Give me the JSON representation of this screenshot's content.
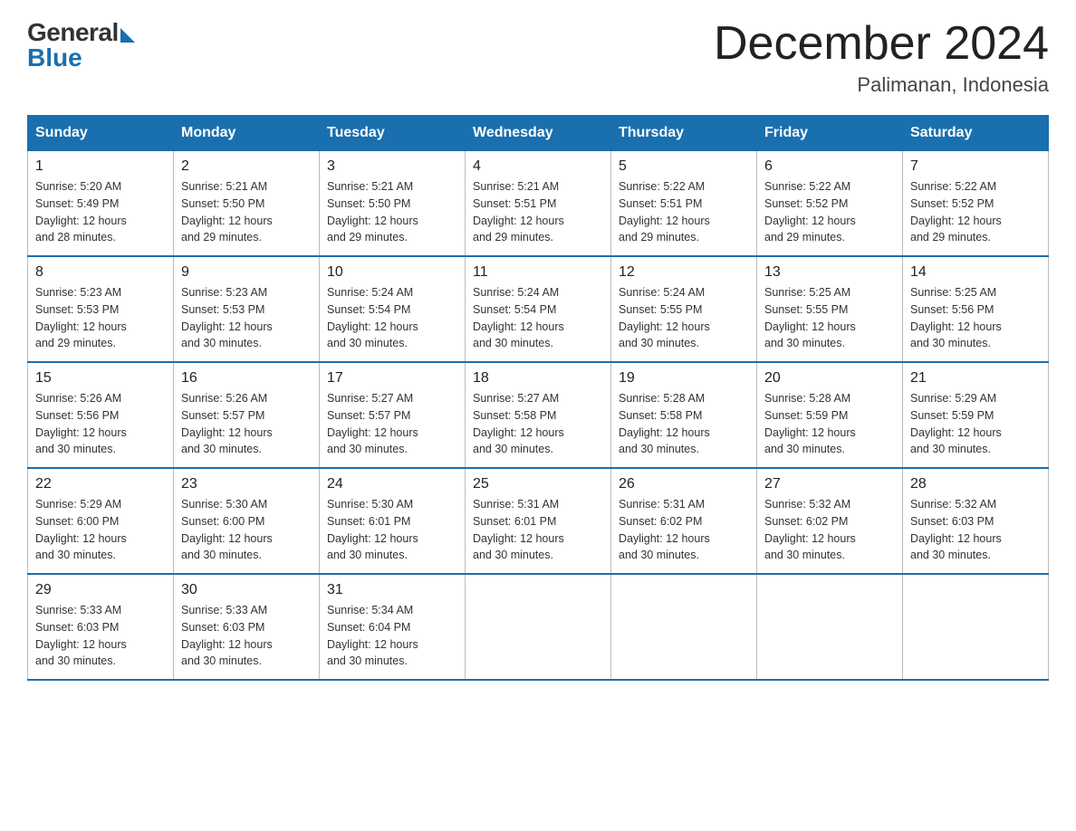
{
  "logo": {
    "general": "General",
    "blue": "Blue"
  },
  "header": {
    "title": "December 2024",
    "location": "Palimanan, Indonesia"
  },
  "weekdays": [
    "Sunday",
    "Monday",
    "Tuesday",
    "Wednesday",
    "Thursday",
    "Friday",
    "Saturday"
  ],
  "weeks": [
    [
      {
        "day": "1",
        "sunrise": "5:20 AM",
        "sunset": "5:49 PM",
        "daylight": "12 hours and 28 minutes."
      },
      {
        "day": "2",
        "sunrise": "5:21 AM",
        "sunset": "5:50 PM",
        "daylight": "12 hours and 29 minutes."
      },
      {
        "day": "3",
        "sunrise": "5:21 AM",
        "sunset": "5:50 PM",
        "daylight": "12 hours and 29 minutes."
      },
      {
        "day": "4",
        "sunrise": "5:21 AM",
        "sunset": "5:51 PM",
        "daylight": "12 hours and 29 minutes."
      },
      {
        "day": "5",
        "sunrise": "5:22 AM",
        "sunset": "5:51 PM",
        "daylight": "12 hours and 29 minutes."
      },
      {
        "day": "6",
        "sunrise": "5:22 AM",
        "sunset": "5:52 PM",
        "daylight": "12 hours and 29 minutes."
      },
      {
        "day": "7",
        "sunrise": "5:22 AM",
        "sunset": "5:52 PM",
        "daylight": "12 hours and 29 minutes."
      }
    ],
    [
      {
        "day": "8",
        "sunrise": "5:23 AM",
        "sunset": "5:53 PM",
        "daylight": "12 hours and 29 minutes."
      },
      {
        "day": "9",
        "sunrise": "5:23 AM",
        "sunset": "5:53 PM",
        "daylight": "12 hours and 30 minutes."
      },
      {
        "day": "10",
        "sunrise": "5:24 AM",
        "sunset": "5:54 PM",
        "daylight": "12 hours and 30 minutes."
      },
      {
        "day": "11",
        "sunrise": "5:24 AM",
        "sunset": "5:54 PM",
        "daylight": "12 hours and 30 minutes."
      },
      {
        "day": "12",
        "sunrise": "5:24 AM",
        "sunset": "5:55 PM",
        "daylight": "12 hours and 30 minutes."
      },
      {
        "day": "13",
        "sunrise": "5:25 AM",
        "sunset": "5:55 PM",
        "daylight": "12 hours and 30 minutes."
      },
      {
        "day": "14",
        "sunrise": "5:25 AM",
        "sunset": "5:56 PM",
        "daylight": "12 hours and 30 minutes."
      }
    ],
    [
      {
        "day": "15",
        "sunrise": "5:26 AM",
        "sunset": "5:56 PM",
        "daylight": "12 hours and 30 minutes."
      },
      {
        "day": "16",
        "sunrise": "5:26 AM",
        "sunset": "5:57 PM",
        "daylight": "12 hours and 30 minutes."
      },
      {
        "day": "17",
        "sunrise": "5:27 AM",
        "sunset": "5:57 PM",
        "daylight": "12 hours and 30 minutes."
      },
      {
        "day": "18",
        "sunrise": "5:27 AM",
        "sunset": "5:58 PM",
        "daylight": "12 hours and 30 minutes."
      },
      {
        "day": "19",
        "sunrise": "5:28 AM",
        "sunset": "5:58 PM",
        "daylight": "12 hours and 30 minutes."
      },
      {
        "day": "20",
        "sunrise": "5:28 AM",
        "sunset": "5:59 PM",
        "daylight": "12 hours and 30 minutes."
      },
      {
        "day": "21",
        "sunrise": "5:29 AM",
        "sunset": "5:59 PM",
        "daylight": "12 hours and 30 minutes."
      }
    ],
    [
      {
        "day": "22",
        "sunrise": "5:29 AM",
        "sunset": "6:00 PM",
        "daylight": "12 hours and 30 minutes."
      },
      {
        "day": "23",
        "sunrise": "5:30 AM",
        "sunset": "6:00 PM",
        "daylight": "12 hours and 30 minutes."
      },
      {
        "day": "24",
        "sunrise": "5:30 AM",
        "sunset": "6:01 PM",
        "daylight": "12 hours and 30 minutes."
      },
      {
        "day": "25",
        "sunrise": "5:31 AM",
        "sunset": "6:01 PM",
        "daylight": "12 hours and 30 minutes."
      },
      {
        "day": "26",
        "sunrise": "5:31 AM",
        "sunset": "6:02 PM",
        "daylight": "12 hours and 30 minutes."
      },
      {
        "day": "27",
        "sunrise": "5:32 AM",
        "sunset": "6:02 PM",
        "daylight": "12 hours and 30 minutes."
      },
      {
        "day": "28",
        "sunrise": "5:32 AM",
        "sunset": "6:03 PM",
        "daylight": "12 hours and 30 minutes."
      }
    ],
    [
      {
        "day": "29",
        "sunrise": "5:33 AM",
        "sunset": "6:03 PM",
        "daylight": "12 hours and 30 minutes."
      },
      {
        "day": "30",
        "sunrise": "5:33 AM",
        "sunset": "6:03 PM",
        "daylight": "12 hours and 30 minutes."
      },
      {
        "day": "31",
        "sunrise": "5:34 AM",
        "sunset": "6:04 PM",
        "daylight": "12 hours and 30 minutes."
      },
      null,
      null,
      null,
      null
    ]
  ],
  "labels": {
    "sunrise": "Sunrise:",
    "sunset": "Sunset:",
    "daylight": "Daylight:"
  }
}
